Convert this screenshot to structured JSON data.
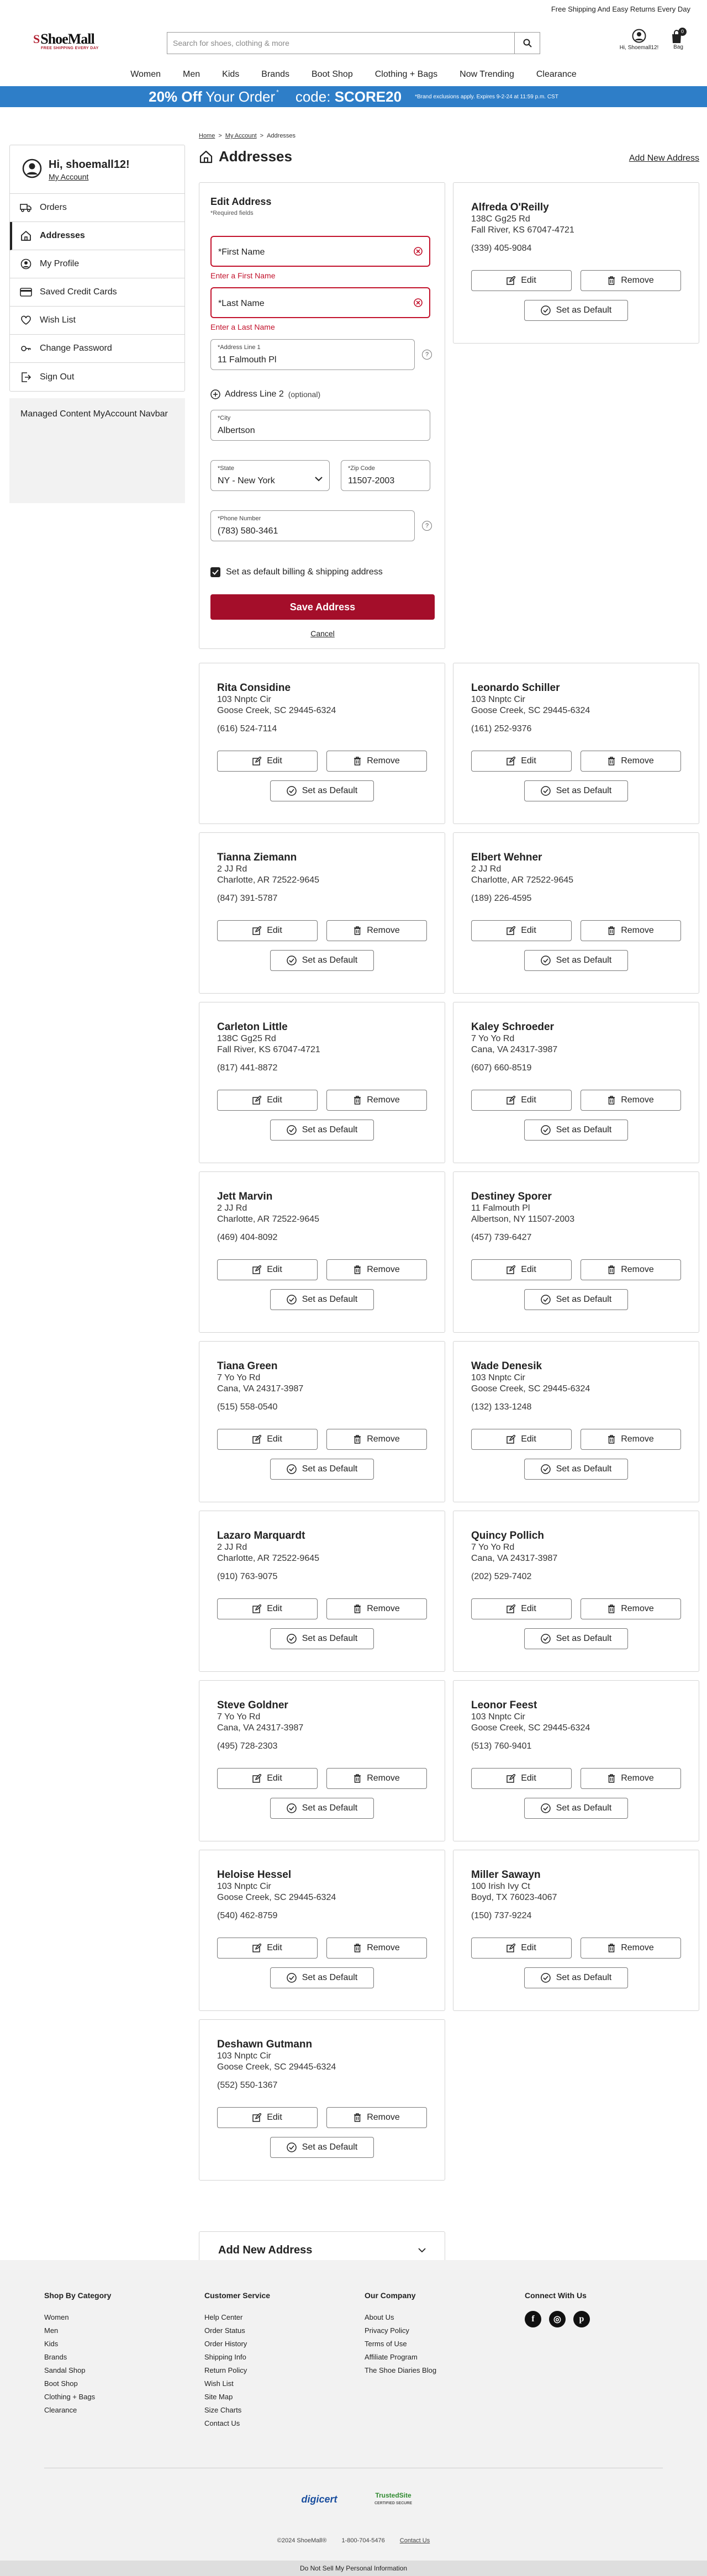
{
  "topbar": {
    "text": "Free Shipping And Easy Returns Every Day"
  },
  "header": {
    "logo_text": "ShoeMall",
    "logo_tagline": "FREE SHIPPING EVERY DAY",
    "search_placeholder": "Search for shoes, clothing & more",
    "user_label": "Hi, Shoemall12!",
    "bag_label": "Bag",
    "bag_count": "0"
  },
  "nav": [
    "Women",
    "Men",
    "Kids",
    "Brands",
    "Boot Shop",
    "Clothing + Bags",
    "Now Trending",
    "Clearance"
  ],
  "promo": {
    "headline_bold": "20% Off",
    "headline_rest": "Your Order",
    "star": "*",
    "code_label": "code:",
    "code": "SCORE20",
    "fine_print": "*Brand exclusions apply. Expires 9-2-24 at 11:59 p.m. CST"
  },
  "breadcrumb": {
    "home": "Home",
    "sep1": ">",
    "account": "My Account",
    "sep2": ">",
    "current": "Addresses"
  },
  "page_title": "Addresses",
  "add_new_link": "Add New Address",
  "sidebar": {
    "greeting": "Hi, shoemall12!",
    "account_link": "My Account",
    "items": [
      "Orders",
      "Addresses",
      "My Profile",
      "Saved Credit Cards",
      "Wish List",
      "Change Password",
      "Sign Out"
    ],
    "active": "Addresses",
    "managed_text": "Managed Content MyAccount Navbar"
  },
  "edit_form": {
    "title": "Edit Address",
    "required_note": "*Required fields",
    "first_name_placeholder": "*First Name",
    "first_name_error": "Enter a First Name",
    "last_name_placeholder": "*Last Name",
    "last_name_error": "Enter a Last Name",
    "address1_label": "*Address Line 1",
    "address1_value": "11 Falmouth Pl",
    "address2_label": "Address Line 2",
    "address2_optional": "(optional)",
    "city_label": "*City",
    "city_value": "Albertson",
    "state_label": "*State",
    "state_value": "NY - New York",
    "zip_label": "*Zip Code",
    "zip_value": "11507-2003",
    "phone_label": "*Phone Number",
    "phone_value": "(783) 580-3461",
    "default_checkbox_label": "Set as default billing & shipping address",
    "default_checked": true,
    "save_label": "Save Address",
    "cancel_label": "Cancel"
  },
  "buttons": {
    "edit": "Edit",
    "remove": "Remove",
    "set_default": "Set as Default"
  },
  "addresses": [
    {
      "name": "Alfreda O'Reilly",
      "street": "138C Gg25 Rd",
      "city_line": "Fall River, KS 67047-4721",
      "phone": "(339) 405-9084"
    },
    {
      "name": "Rita Considine",
      "street": "103 Nnptc Cir",
      "city_line": "Goose Creek, SC 29445-6324",
      "phone": "(616) 524-7114"
    },
    {
      "name": "Leonardo Schiller",
      "street": "103 Nnptc Cir",
      "city_line": "Goose Creek, SC 29445-6324",
      "phone": "(161) 252-9376"
    },
    {
      "name": "Tianna Ziemann",
      "street": "2 JJ Rd",
      "city_line": "Charlotte, AR 72522-9645",
      "phone": "(847) 391-5787"
    },
    {
      "name": "Elbert Wehner",
      "street": "2 JJ Rd",
      "city_line": "Charlotte, AR 72522-9645",
      "phone": "(189) 226-4595"
    },
    {
      "name": "Carleton Little",
      "street": "138C Gg25 Rd",
      "city_line": "Fall River, KS 67047-4721",
      "phone": "(817) 441-8872"
    },
    {
      "name": "Kaley Schroeder",
      "street": "7 Yo Yo Rd",
      "city_line": "Cana, VA 24317-3987",
      "phone": "(607) 660-8519"
    },
    {
      "name": "Jett Marvin",
      "street": "2 JJ Rd",
      "city_line": "Charlotte, AR 72522-9645",
      "phone": "(469) 404-8092"
    },
    {
      "name": "Destiney Sporer",
      "street": "11 Falmouth Pl",
      "city_line": "Albertson, NY 11507-2003",
      "phone": "(457) 739-6427"
    },
    {
      "name": "Tiana Green",
      "street": "7 Yo Yo Rd",
      "city_line": "Cana, VA 24317-3987",
      "phone": "(515) 558-0540"
    },
    {
      "name": "Wade Denesik",
      "street": "103 Nnptc Cir",
      "city_line": "Goose Creek, SC 29445-6324",
      "phone": "(132) 133-1248"
    },
    {
      "name": "Lazaro Marquardt",
      "street": "2 JJ Rd",
      "city_line": "Charlotte, AR 72522-9645",
      "phone": "(910) 763-9075"
    },
    {
      "name": "Quincy Pollich",
      "street": "7 Yo Yo Rd",
      "city_line": "Cana, VA 24317-3987",
      "phone": "(202) 529-7402"
    },
    {
      "name": "Steve Goldner",
      "street": "7 Yo Yo Rd",
      "city_line": "Cana, VA 24317-3987",
      "phone": "(495) 728-2303"
    },
    {
      "name": "Leonor Feest",
      "street": "103 Nnptc Cir",
      "city_line": "Goose Creek, SC 29445-6324",
      "phone": "(513) 760-9401"
    },
    {
      "name": "Heloise Hessel",
      "street": "103 Nnptc Cir",
      "city_line": "Goose Creek, SC 29445-6324",
      "phone": "(540) 462-8759"
    },
    {
      "name": "Miller Sawayn",
      "street": "100 Irish Ivy Ct",
      "city_line": "Boyd, TX 76023-4067",
      "phone": "(150) 737-9224"
    },
    {
      "name": "Deshawn Gutmann",
      "street": "103 Nnptc Cir",
      "city_line": "Goose Creek, SC 29445-6324",
      "phone": "(552) 550-1367"
    }
  ],
  "add_new_accordion": "Add New Address",
  "footer": {
    "columns": [
      {
        "title": "Shop By Category",
        "links": [
          "Women",
          "Men",
          "Kids",
          "Brands",
          "Sandal Shop",
          "Boot Shop",
          "Clothing + Bags",
          "Clearance"
        ]
      },
      {
        "title": "Customer Service",
        "links": [
          "Help Center",
          "Order Status",
          "Order History",
          "Shipping Info",
          "Return Policy",
          "Wish List",
          "Site Map",
          "Size Charts",
          "Contact Us"
        ]
      },
      {
        "title": "Our Company",
        "links": [
          "About Us",
          "Privacy Policy",
          "Terms of Use",
          "Affiliate Program",
          "The Shoe Diaries Blog"
        ]
      }
    ],
    "connect_title": "Connect With Us",
    "social": [
      {
        "icon": "facebook-icon",
        "glyph": "f"
      },
      {
        "icon": "instagram-icon",
        "glyph": "◎"
      },
      {
        "icon": "pinterest-icon",
        "glyph": "p"
      }
    ],
    "badge_digicert": "digicert",
    "badge_trusted": "TrustedSite",
    "badge_trusted_sub": "CERTIFIED SECURE",
    "copyright": "©2024 ShoeMall®",
    "phone": "1-800-704-5476",
    "contact": "Contact Us",
    "dnsmpi": "Do Not Sell My Personal Information"
  },
  "colors": {
    "brand_red": "#a40e2a",
    "promo_blue": "#2e7ec8",
    "error_red": "#c2112b"
  }
}
